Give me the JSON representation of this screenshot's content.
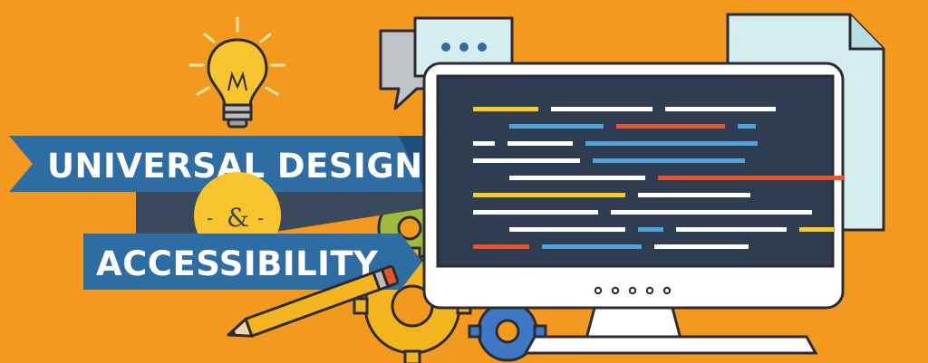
{
  "banner": {
    "line1": "UNIVERSAL DESIGN",
    "ampersand": "&",
    "dash_left": "-",
    "dash_right": "-",
    "line2": "ACCESSIBILITY"
  },
  "colors": {
    "background": "#F39A1E",
    "ribbon": "#2E6CA4",
    "ribbon_shadow": "#1E4E7C",
    "dark_band": "#3A4A5C",
    "badge": "#F7C42E",
    "screen": "#2E3D52",
    "outline": "#2B2B35",
    "code_white": "#FFFFFF",
    "code_yellow": "#F7CF22",
    "code_blue": "#4FA3DB",
    "code_red": "#E8522C"
  },
  "icons": [
    "lightbulb-icon",
    "chat-bubbles-icon",
    "document-icon",
    "gears-icon",
    "pencil-icon",
    "monitor-icon",
    "keyboard-icon"
  ],
  "code_lines": [
    [
      [
        "yellow",
        72
      ],
      [
        "white",
        112
      ],
      [
        "white",
        122
      ]
    ],
    [
      [
        "blue",
        104
      ],
      [
        "red",
        120
      ],
      [
        "blue",
        20
      ]
    ],
    [
      [
        "white",
        24
      ],
      [
        "white",
        72
      ],
      [
        "blue",
        190
      ]
    ],
    [
      [
        "white",
        118
      ],
      [
        "blue",
        168
      ]
    ],
    [
      [
        "white",
        150
      ],
      [
        "red",
        206
      ]
    ],
    [
      [
        "yellow",
        168
      ],
      [
        "white",
        124
      ]
    ],
    [
      [
        "white",
        138
      ],
      [
        "white",
        222
      ]
    ],
    [
      [
        "white",
        128
      ],
      [
        "blue",
        28
      ],
      [
        "white",
        122
      ],
      [
        "yellow",
        38
      ]
    ],
    [
      [
        "red",
        62
      ],
      [
        "blue",
        110
      ],
      [
        "white",
        104
      ]
    ]
  ],
  "monitor_dots": 5
}
